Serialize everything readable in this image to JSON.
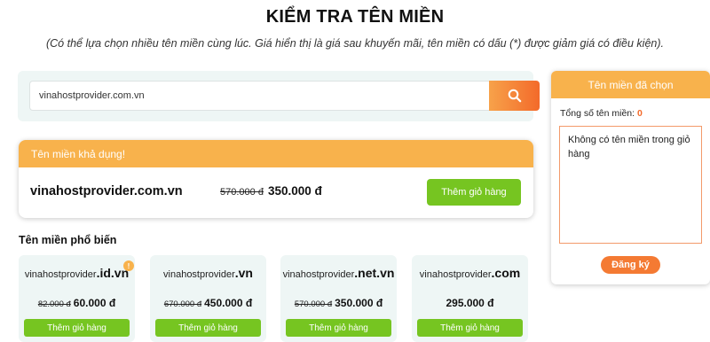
{
  "header": {
    "title": "KIỂM TRA TÊN MIỀN",
    "subtitle": "(Có thể lựa chọn nhiều tên miền cùng lúc. Giá hiển thị là giá sau khuyến mãi, tên miền có dấu (*) được giảm giá có điều kiện)."
  },
  "search": {
    "value": "vinahostprovider.com.vn",
    "icon": "search-icon"
  },
  "result": {
    "header": "Tên miền khả dụng!",
    "domain": "vinahostprovider.com.vn",
    "old_price": "570.000 đ",
    "price": "350.000 đ",
    "add_label": "Thêm giỏ hàng"
  },
  "popular": {
    "heading": "Tên miền phổ biến",
    "items": [
      {
        "name": "vinahostprovider",
        "tld": ".id.vn",
        "old_price": "82.000 đ",
        "price": "60.000 đ",
        "add_label": "Thêm giỏ hàng",
        "badge": "!"
      },
      {
        "name": "vinahostprovider",
        "tld": ".vn",
        "old_price": "670.000 đ",
        "price": "450.000 đ",
        "add_label": "Thêm giỏ hàng"
      },
      {
        "name": "vinahostprovider",
        "tld": ".net.vn",
        "old_price": "570.000 đ",
        "price": "350.000 đ",
        "add_label": "Thêm giỏ hàng"
      },
      {
        "name": "vinahostprovider",
        "tld": ".com",
        "old_price": "",
        "price": "295.000 đ",
        "add_label": "Thêm giỏ hàng"
      }
    ]
  },
  "cart": {
    "header": "Tên miền đã chọn",
    "count_label": "Tổng số tên miền:",
    "count_value": "0",
    "textarea": "Không có tên miền trong giỏ hàng",
    "register_label": "Đăng ký"
  },
  "colors": {
    "accent_orange": "#f8b24c",
    "button_green": "#76c521",
    "search_orange": "#f36a2a",
    "panel_bg": "#eef6f5"
  }
}
